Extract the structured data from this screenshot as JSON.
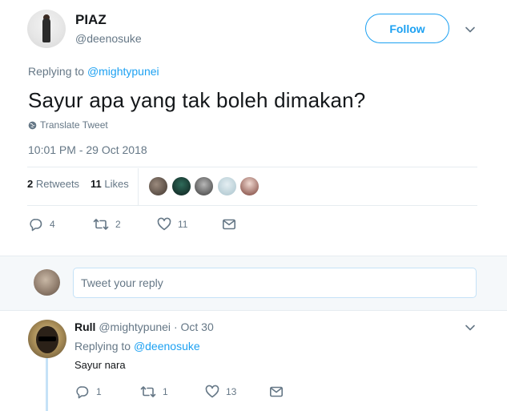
{
  "main_tweet": {
    "user": {
      "name": "PIAZ",
      "handle": "@deenosuke"
    },
    "follow_label": "Follow",
    "replying_prefix": "Replying to",
    "replying_to": "@mightypunei",
    "text": "Sayur apa yang tak boleh dimakan?",
    "translate_label": "Translate Tweet",
    "timestamp": "10:01 PM - 29 Oct 2018",
    "retweets_count": "2",
    "retweets_label": "Retweets",
    "likes_count": "11",
    "likes_label": "Likes",
    "actions": {
      "reply_count": "4",
      "retweet_count": "2",
      "like_count": "11"
    }
  },
  "reply_box": {
    "placeholder": "Tweet your reply"
  },
  "reply_tweet": {
    "user": {
      "name": "Rull",
      "handle": "@mightypunei",
      "date": "· Oct 30"
    },
    "replying_prefix": "Replying to",
    "replying_to": "@deenosuke",
    "text": "Sayur nara",
    "actions": {
      "reply_count": "1",
      "retweet_count": "1",
      "like_count": "13"
    }
  },
  "colors": {
    "accent": "#1da1f2",
    "muted": "#657786",
    "text": "#14171a",
    "border": "#e6ecf0"
  },
  "icons": [
    "globe-icon",
    "chevron-down-icon",
    "reply-icon",
    "retweet-icon",
    "like-icon",
    "dm-icon"
  ]
}
